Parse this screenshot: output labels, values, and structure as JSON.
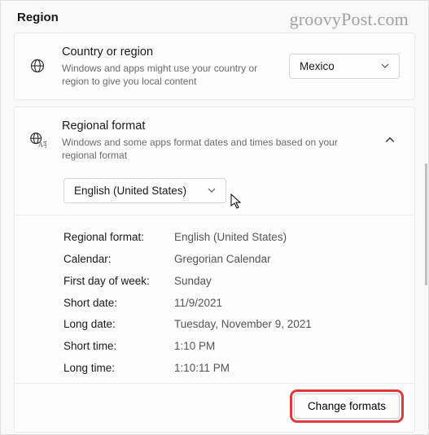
{
  "pageTitle": "Region",
  "watermark": "groovyPost.com",
  "countryCard": {
    "title": "Country or region",
    "subtitle": "Windows and apps might use your country or region to give you local content",
    "selected": "Mexico"
  },
  "formatCard": {
    "title": "Regional format",
    "subtitle": "Windows and some apps format dates and times based on your regional format",
    "selectedLocale": "English (United States)",
    "rows": [
      {
        "label": "Regional format:",
        "value": "English (United States)"
      },
      {
        "label": "Calendar:",
        "value": "Gregorian Calendar"
      },
      {
        "label": "First day of week:",
        "value": "Sunday"
      },
      {
        "label": "Short date:",
        "value": "11/9/2021"
      },
      {
        "label": "Long date:",
        "value": "Tuesday, November 9, 2021"
      },
      {
        "label": "Short time:",
        "value": "1:10 PM"
      },
      {
        "label": "Long time:",
        "value": "1:10:11 PM"
      }
    ],
    "changeFormatsLabel": "Change formats"
  }
}
